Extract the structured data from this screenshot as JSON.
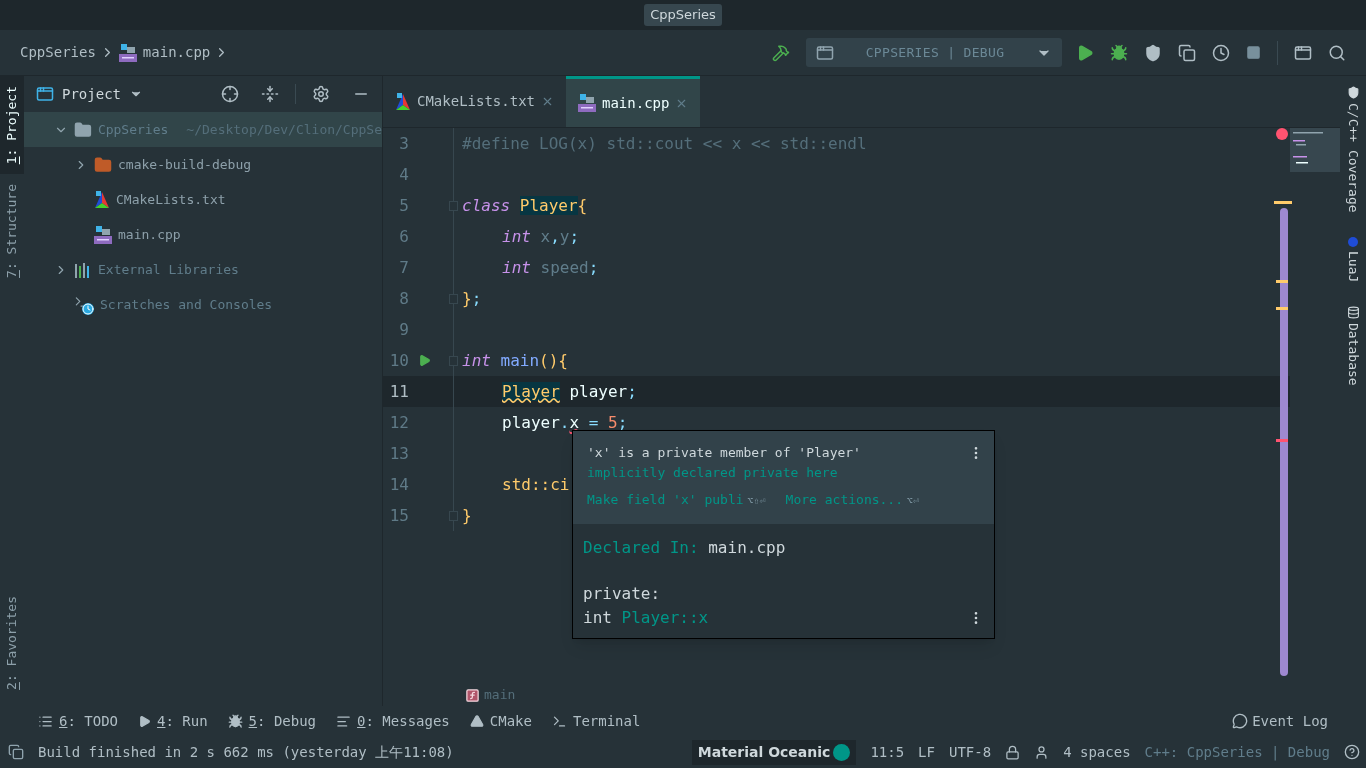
{
  "window": {
    "title": "CppSeries"
  },
  "breadcrumb": [
    "CppSeries",
    "main.cpp"
  ],
  "run_config": {
    "label": "CPPSERIES | DEBUG"
  },
  "left_stripe": [
    {
      "number": "1",
      "label": ": Project",
      "selected": true
    },
    {
      "number": "7",
      "label": ": Structure",
      "selected": false
    },
    {
      "number": "2",
      "label": ": Favorites",
      "selected": false
    }
  ],
  "right_stripe": [
    {
      "label": "C/C++ Coverage"
    },
    {
      "label": "LuaJ"
    },
    {
      "label": "Database"
    }
  ],
  "project_panel": {
    "title": "Project",
    "tree": [
      {
        "name": "CppSeries",
        "path": "~/Desktop/Dev/Clion/CppSe",
        "kind": "folder",
        "expanded": true,
        "selected": true,
        "children": [
          {
            "name": "cmake-build-debug",
            "kind": "build-folder",
            "expanded": false,
            "selected": false
          },
          {
            "name": "CMakeLists.txt",
            "kind": "cmake",
            "selected": false
          },
          {
            "name": "main.cpp",
            "kind": "cpp",
            "selected": false
          }
        ]
      },
      {
        "name": "External Libraries",
        "kind": "libraries",
        "expanded": false,
        "selected": false
      },
      {
        "name": "Scratches and Consoles",
        "kind": "scratches",
        "selected": false
      }
    ]
  },
  "tabs": [
    {
      "label": "CMakeLists.txt",
      "kind": "cmake",
      "selected": false
    },
    {
      "label": "main.cpp",
      "kind": "cpp",
      "selected": true
    }
  ],
  "code": [
    {
      "number": "3",
      "current": false,
      "indent": false,
      "tokens": [
        {
          "t": "#define LOG(x) std::cout << x << std::endl",
          "kind": "macro"
        }
      ]
    },
    {
      "number": "4",
      "current": false
    },
    {
      "number": "5",
      "current": false,
      "indent": false,
      "fold": true,
      "tokens": [
        {
          "t": "class ",
          "kind": "keyword"
        },
        {
          "t": "Player",
          "kind": "type-hl"
        },
        {
          "t": "{",
          "kind": "brace"
        }
      ]
    },
    {
      "number": "6",
      "current": false,
      "indent": true,
      "tokens": [
        {
          "t": "int",
          "kind": "keyword"
        },
        {
          "t": " x",
          "kind": "field"
        },
        {
          "t": ",",
          "kind": "punct"
        },
        {
          "t": "y",
          "kind": "field"
        },
        {
          "t": ";",
          "kind": "punct"
        }
      ]
    },
    {
      "number": "7",
      "current": false,
      "indent": true,
      "tokens": [
        {
          "t": "int",
          "kind": "keyword"
        },
        {
          "t": " speed",
          "kind": "field"
        },
        {
          "t": ";",
          "kind": "punct"
        }
      ]
    },
    {
      "number": "8",
      "current": false,
      "indent": false,
      "fold": true,
      "tokens": [
        {
          "t": "}",
          "kind": "brace"
        },
        {
          "t": ";",
          "kind": "punct"
        }
      ]
    },
    {
      "number": "9",
      "current": false
    },
    {
      "number": "10",
      "current": false,
      "indent": false,
      "fold": true,
      "run": true,
      "tokens": [
        {
          "t": "int ",
          "kind": "keyword"
        },
        {
          "t": "main",
          "kind": "func"
        },
        {
          "t": "(){",
          "kind": "brace"
        }
      ]
    },
    {
      "number": "11",
      "current": true,
      "indent": true,
      "tokens": [
        {
          "t": "Player",
          "kind": "type-warn"
        },
        {
          "t": " player",
          "kind": "plain"
        },
        {
          "t": ";",
          "kind": "punct"
        }
      ]
    },
    {
      "number": "12",
      "current": false,
      "indent": true,
      "tokens": [
        {
          "t": "player",
          "kind": "plain"
        },
        {
          "t": ".",
          "kind": "punct"
        },
        {
          "t": "x",
          "kind": "error"
        },
        {
          "t": " = ",
          "kind": "punct"
        },
        {
          "t": "5",
          "kind": "number"
        },
        {
          "t": ";",
          "kind": "punct"
        }
      ]
    },
    {
      "number": "13",
      "current": false
    },
    {
      "number": "14",
      "current": false,
      "indent": true,
      "tokens": [
        {
          "t": "std::ci",
          "kind": "brace"
        }
      ]
    },
    {
      "number": "15",
      "current": false,
      "indent": false,
      "fold": true,
      "tokens": [
        {
          "t": "}",
          "kind": "brace"
        }
      ]
    }
  ],
  "popup": {
    "message": "'x' is a private member of 'Player'",
    "link": "implicitly declared private here",
    "actions": [
      {
        "label": "Make field 'x' publi",
        "shortcut": "⌥⇧⏎"
      },
      {
        "label": "More actions...",
        "shortcut": "⌥⏎"
      }
    ],
    "declared_label": "Declared In:",
    "declared_file": "main.cpp",
    "access": "private:",
    "signature_type": "int",
    "signature_name": "Player::x"
  },
  "editor_breadcrumb": "main",
  "tool_tabs": [
    {
      "number": "6",
      "label": ": TODO",
      "kind": "todo"
    },
    {
      "number": "4",
      "label": ": Run",
      "kind": "run"
    },
    {
      "number": "5",
      "label": ": Debug",
      "kind": "debug"
    },
    {
      "number": "0",
      "label": ": Messages",
      "kind": "messages"
    },
    {
      "label": "CMake",
      "kind": "cmake"
    },
    {
      "label": "Terminal",
      "kind": "terminal"
    }
  ],
  "event_log": "Event Log",
  "status_bar": {
    "message": "Build finished in 2 s 662 ms (yesterday 上午11:08)",
    "theme": "Material Oceanic",
    "position": "11:5",
    "line_ending": "LF",
    "encoding": "UTF-8",
    "indent": "4 spaces",
    "context": "C++: CppSeries | Debug"
  }
}
